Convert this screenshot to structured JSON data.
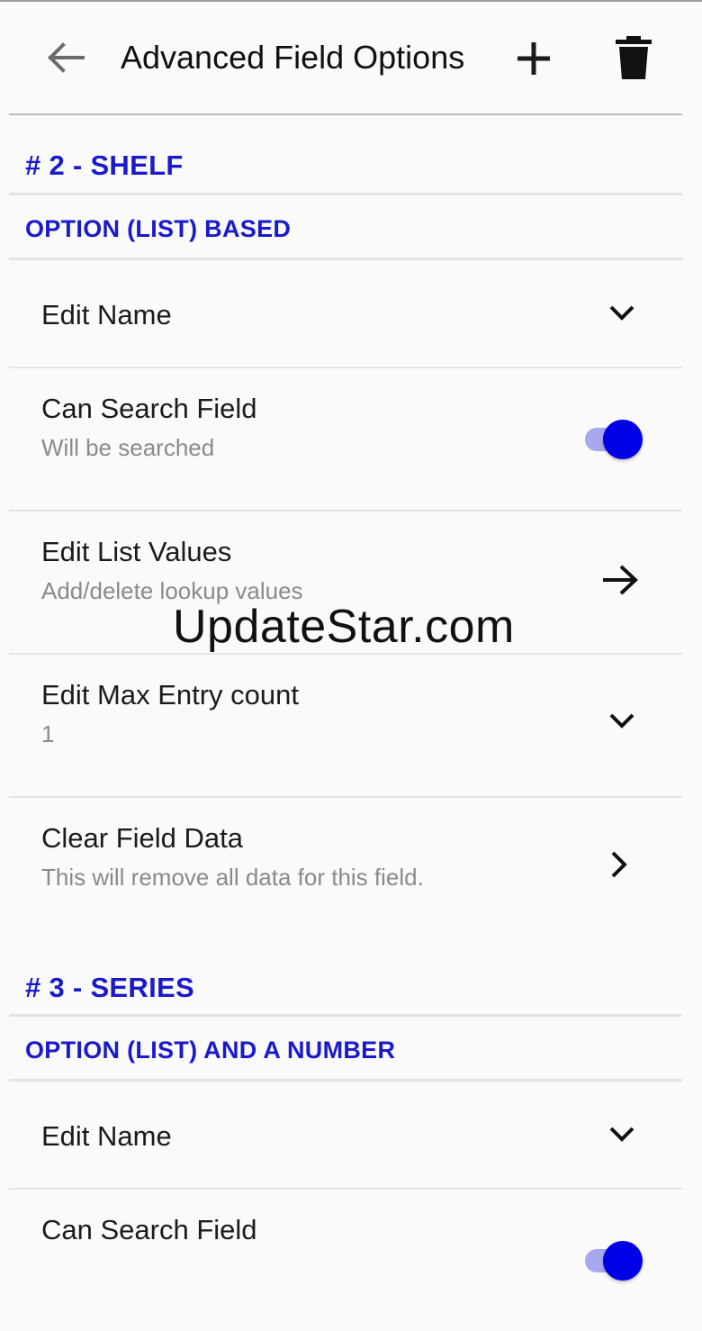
{
  "appbar": {
    "title": "Advanced Field Options",
    "icons": {
      "back": "arrow-left-icon",
      "add": "plus-icon",
      "delete": "trash-icon"
    }
  },
  "colors": {
    "accent": "#1a1acd",
    "toggle_knob": "#0000e6",
    "toggle_track": "#a8a8ef"
  },
  "sections": [
    {
      "header": "# 2 - SHELF",
      "subheader": "OPTION (LIST) BASED",
      "rows": [
        {
          "label": "Edit Name",
          "icon": "chevron-down-icon"
        },
        {
          "label": "Can Search Field",
          "sub": "Will be searched",
          "toggle": true
        },
        {
          "label": "Edit List Values",
          "sub": "Add/delete lookup values",
          "icon": "arrow-right-icon"
        },
        {
          "label": "Edit Max Entry count",
          "sub": "1",
          "icon": "chevron-down-icon"
        },
        {
          "label": "Clear Field Data",
          "sub": "This will remove all data for this field.",
          "icon": "chevron-right-icon"
        }
      ]
    },
    {
      "header": "# 3 - SERIES",
      "subheader": "OPTION (LIST) AND A NUMBER",
      "rows": [
        {
          "label": "Edit Name",
          "icon": "chevron-down-icon"
        },
        {
          "label": "Can Search Field",
          "toggle": true
        }
      ]
    }
  ],
  "watermark": "UpdateStar.com"
}
